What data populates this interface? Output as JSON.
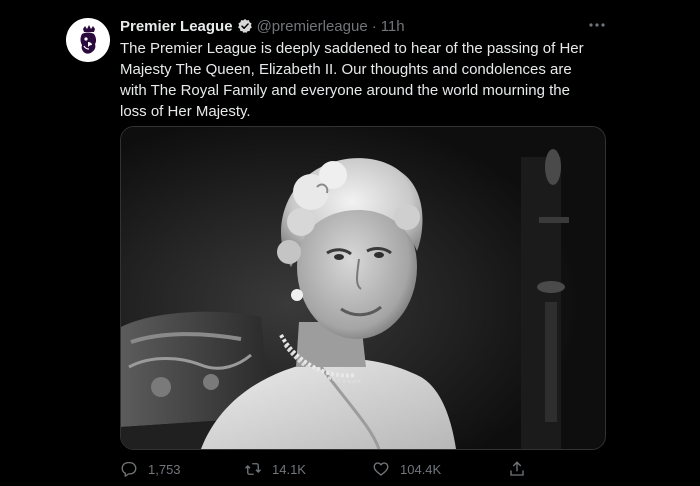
{
  "tweet": {
    "display_name": "Premier League",
    "handle": "@premierleague",
    "separator": "·",
    "time": "11h",
    "text": "The Premier League is deeply saddened to hear of the passing of Her Majesty The Queen, Elizabeth II. Our thoughts and condolences are with The Royal Family and everyone around the world mourning the loss of Her Majesty.",
    "avatar_icon": "premier-league-lion-icon",
    "verified_icon": "verified-badge-icon",
    "more_icon": "more-options-icon"
  },
  "actions": {
    "reply_count": "1,753",
    "retweet_count": "14.1K",
    "like_count": "104.4K",
    "icons": [
      "reply-icon",
      "retweet-icon",
      "like-icon",
      "share-icon"
    ]
  },
  "colors": {
    "background": "#000000",
    "text": "#e7e9ea",
    "secondary_text": "#71767b",
    "border": "#2f3336"
  }
}
